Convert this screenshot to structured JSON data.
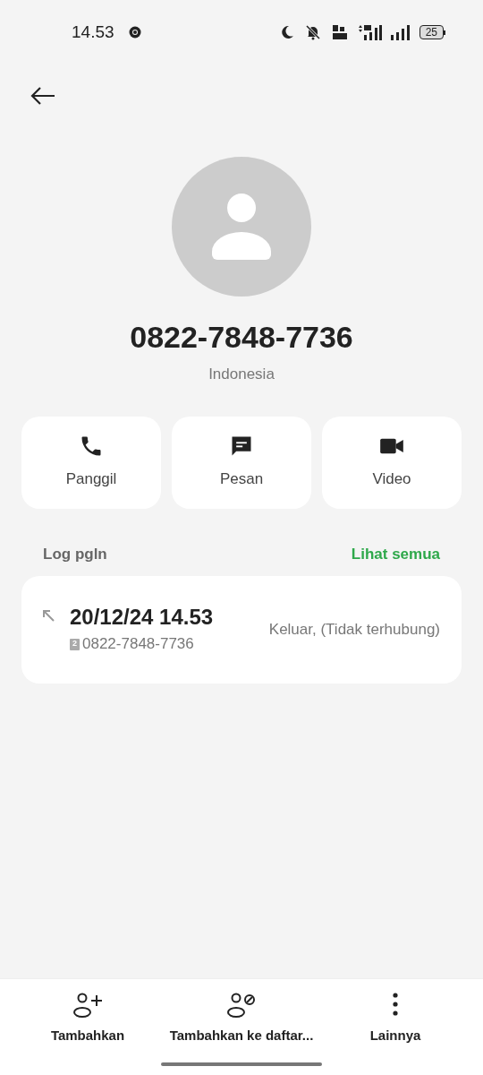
{
  "status_bar": {
    "time": "14.53",
    "battery": "25"
  },
  "contact": {
    "number": "0822-7848-7736",
    "country": "Indonesia"
  },
  "actions": [
    {
      "kind": "call",
      "label": "Panggil"
    },
    {
      "kind": "message",
      "label": "Pesan"
    },
    {
      "kind": "video",
      "label": "Video"
    }
  ],
  "call_log": {
    "title": "Log pgln",
    "see_all": "Lihat semua",
    "entries": [
      {
        "datetime": "20/12/24 14.53",
        "sim": "2",
        "number": "0822-7848-7736",
        "status": "Keluar, (Tidak terhubung)"
      }
    ]
  },
  "bottom_bar": [
    {
      "kind": "add-contact",
      "label": "Tambahkan"
    },
    {
      "kind": "block",
      "label": "Tambahkan ke daftar..."
    },
    {
      "kind": "more",
      "label": "Lainnya"
    }
  ]
}
